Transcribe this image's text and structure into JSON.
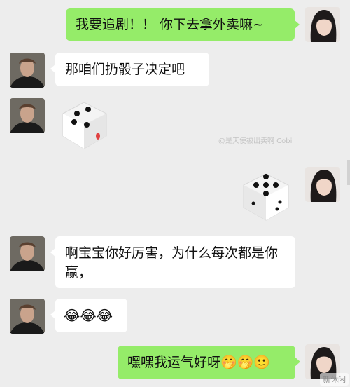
{
  "messages": [
    {
      "side": "out",
      "type": "text",
      "text": "我要追剧！！ 你下去拿外卖嘛~"
    },
    {
      "side": "in",
      "type": "text",
      "text": "那咱们扔骰子决定吧"
    },
    {
      "side": "in",
      "type": "dice",
      "dice_value": 4
    },
    {
      "side": "out",
      "type": "dice",
      "dice_value": 5
    },
    {
      "side": "in",
      "type": "text",
      "text": "啊宝宝你好厉害，为什么每次都是你赢，"
    },
    {
      "side": "in",
      "type": "emoji",
      "emojis": [
        "😂",
        "😂",
        "😂"
      ]
    },
    {
      "side": "out",
      "type": "text",
      "text": "嘿嘿我运气好呀",
      "emojis": [
        "🤭",
        "🤭",
        "🙂"
      ]
    }
  ],
  "watermark": "@是天使被出卖啊 Cobi",
  "corner_logo": "新休闲"
}
